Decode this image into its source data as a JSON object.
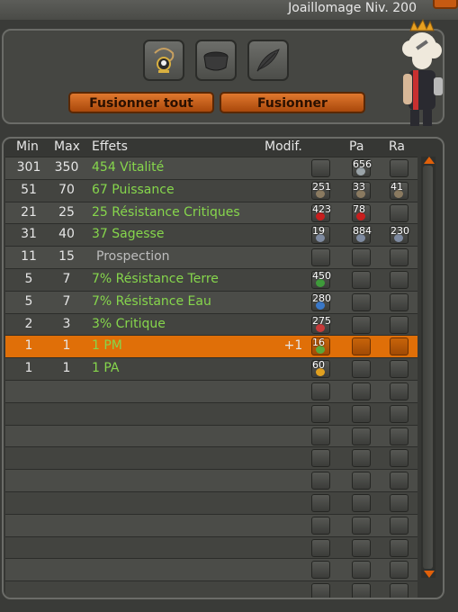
{
  "window": {
    "title": "Joaillomage Niv. 200"
  },
  "buttons": {
    "merge_all": "Fusionner tout",
    "merge": "Fusionner"
  },
  "slots": [
    "item-slot-amulet",
    "item-slot-rune-basket",
    "item-slot-feather"
  ],
  "table": {
    "headers": {
      "min": "Min",
      "max": "Max",
      "effects": "Effets",
      "modif": "Modif.",
      "pa": "Pa",
      "ra": "Ra"
    },
    "rows": [
      {
        "min": "301",
        "max": "350",
        "effect": "454 Vitalité",
        "modif": "",
        "ba": "",
        "pa": "656",
        "ra": "",
        "rune_color": "#9aa3a8"
      },
      {
        "min": "51",
        "max": "70",
        "effect": "67 Puissance",
        "modif": "",
        "ba": "251",
        "pa": "33",
        "ra": "41",
        "rune_color": "#8a7a60"
      },
      {
        "min": "21",
        "max": "25",
        "effect": "25 Résistance Critiques",
        "modif": "",
        "ba": "423",
        "pa": "78",
        "ra": "",
        "rune_color": "#c81e1e"
      },
      {
        "min": "31",
        "max": "40",
        "effect": "37 Sagesse",
        "modif": "",
        "ba": "19",
        "pa": "884",
        "ra": "230",
        "rune_color": "#7e8aa0"
      },
      {
        "min": "11",
        "max": "15",
        "effect": "Prospection",
        "modif": "",
        "ba": "",
        "pa": "",
        "ra": "",
        "rune_color": ""
      },
      {
        "min": "5",
        "max": "7",
        "effect": "7% Résistance Terre",
        "modif": "",
        "ba": "450",
        "pa": "",
        "ra": "",
        "rune_color": "#3e9a3a"
      },
      {
        "min": "5",
        "max": "7",
        "effect": "7% Résistance Eau",
        "modif": "",
        "ba": "280",
        "pa": "",
        "ra": "",
        "rune_color": "#3a78c8"
      },
      {
        "min": "2",
        "max": "3",
        "effect": "3% Critique",
        "modif": "",
        "ba": "275",
        "pa": "",
        "ra": "",
        "rune_color": "#c83a3a"
      },
      {
        "min": "1",
        "max": "1",
        "effect": "1 PM",
        "modif": "+1",
        "ba": "16",
        "pa": "",
        "ra": "",
        "rune_color": "#5aa83a"
      },
      {
        "min": "1",
        "max": "1",
        "effect": "1 PA",
        "modif": "",
        "ba": "60",
        "pa": "",
        "ra": "",
        "rune_color": "#e0a020"
      }
    ],
    "empty_rows": 10
  },
  "colors": {
    "accent": "#e06f08",
    "effect_green": "#86d64c"
  }
}
